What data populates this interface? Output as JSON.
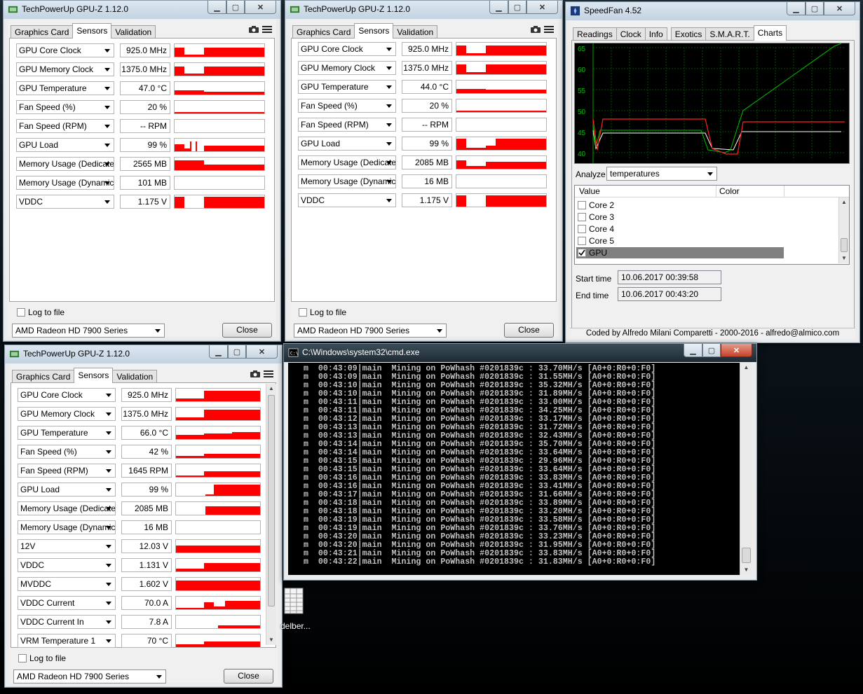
{
  "gpuz": {
    "title": "TechPowerUp GPU-Z 1.12.0",
    "tabs": [
      "Graphics Card",
      "Sensors",
      "Validation"
    ],
    "log_label": "Log to file",
    "card_name": "AMD Radeon HD 7900 Series",
    "close_label": "Close"
  },
  "gpuz1": {
    "sensors": [
      {
        "name": "GPU Core Clock",
        "value": "925.0 MHz"
      },
      {
        "name": "GPU Memory Clock",
        "value": "1375.0 MHz"
      },
      {
        "name": "GPU Temperature",
        "value": "47.0 °C"
      },
      {
        "name": "Fan Speed (%)",
        "value": "20 %"
      },
      {
        "name": "Fan Speed (RPM)",
        "value": "-- RPM"
      },
      {
        "name": "GPU Load",
        "value": "99 %"
      },
      {
        "name": "Memory Usage (Dedicated)",
        "value": "2565 MB"
      },
      {
        "name": "Memory Usage (Dynamic)",
        "value": "101 MB"
      },
      {
        "name": "VDDC",
        "value": "1.175 V"
      }
    ]
  },
  "gpuz2": {
    "sensors": [
      {
        "name": "GPU Core Clock",
        "value": "925.0 MHz"
      },
      {
        "name": "GPU Memory Clock",
        "value": "1375.0 MHz"
      },
      {
        "name": "GPU Temperature",
        "value": "44.0 °C"
      },
      {
        "name": "Fan Speed (%)",
        "value": "20 %"
      },
      {
        "name": "Fan Speed (RPM)",
        "value": "-- RPM"
      },
      {
        "name": "GPU Load",
        "value": "99 %"
      },
      {
        "name": "Memory Usage (Dedicated)",
        "value": "2085 MB"
      },
      {
        "name": "Memory Usage (Dynamic)",
        "value": "16 MB"
      },
      {
        "name": "VDDC",
        "value": "1.175 V"
      }
    ]
  },
  "gpuz3": {
    "sensors": [
      {
        "name": "GPU Core Clock",
        "value": "925.0 MHz"
      },
      {
        "name": "GPU Memory Clock",
        "value": "1375.0 MHz"
      },
      {
        "name": "GPU Temperature",
        "value": "66.0 °C"
      },
      {
        "name": "Fan Speed (%)",
        "value": "42 %"
      },
      {
        "name": "Fan Speed (RPM)",
        "value": "1645 RPM"
      },
      {
        "name": "GPU Load",
        "value": "99 %"
      },
      {
        "name": "Memory Usage (Dedicated)",
        "value": "2085 MB"
      },
      {
        "name": "Memory Usage (Dynamic)",
        "value": "16 MB"
      },
      {
        "name": "12V",
        "value": "12.03 V"
      },
      {
        "name": "VDDC",
        "value": "1.131 V"
      },
      {
        "name": "MVDDC",
        "value": "1.602 V"
      },
      {
        "name": "VDDC Current",
        "value": "70.0 A"
      },
      {
        "name": "VDDC Current In",
        "value": "7.8 A"
      },
      {
        "name": "VRM Temperature 1",
        "value": "70 °C"
      }
    ]
  },
  "speedfan": {
    "title": "SpeedFan 4.52",
    "tabs": [
      "Readings",
      "Clock",
      "Info",
      "Exotics",
      "S.M.A.R.T.",
      "Charts"
    ],
    "y_ticks": [
      "65",
      "60",
      "55",
      "50",
      "45",
      "40"
    ],
    "analyze_label": "Analyze",
    "analyze_value": "temperatures",
    "list_headers": [
      "Value",
      "Color"
    ],
    "list_items": [
      {
        "label": "Core 2",
        "checked": false
      },
      {
        "label": "Core 3",
        "checked": false
      },
      {
        "label": "Core 4",
        "checked": false
      },
      {
        "label": "Core 5",
        "checked": false
      },
      {
        "label": "GPU",
        "checked": true
      }
    ],
    "start_label": "Start time",
    "start_value": "10.06.2017 00:39:58",
    "end_label": "End time",
    "end_value": "10.06.2017 00:43:20",
    "footer": "Coded by Alfredo Milani Comparetti - 2000-2016 - alfredo@almico.com"
  },
  "cmd": {
    "title": "C:\\Windows\\system32\\cmd.exe",
    "lines": [
      "  m  00:43:09|main  Mining on PoWhash #0201839c : 33.70MH/s [A0+0:R0+0:F0]",
      "  m  00:43:09|main  Mining on PoWhash #0201839c : 31.55MH/s [A0+0:R0+0:F0]",
      "  m  00:43:10|main  Mining on PoWhash #0201839c : 35.32MH/s [A0+0:R0+0:F0]",
      "  m  00:43:10|main  Mining on PoWhash #0201839c : 31.89MH/s [A0+0:R0+0:F0]",
      "  m  00:43:11|main  Mining on PoWhash #0201839c : 33.00MH/s [A0+0:R0+0:F0]",
      "  m  00:43:11|main  Mining on PoWhash #0201839c : 34.25MH/s [A0+0:R0+0:F0]",
      "  m  00:43:12|main  Mining on PoWhash #0201839c : 33.17MH/s [A0+0:R0+0:F0]",
      "  m  00:43:13|main  Mining on PoWhash #0201839c : 31.72MH/s [A0+0:R0+0:F0]",
      "  m  00:43:13|main  Mining on PoWhash #0201839c : 32.43MH/s [A0+0:R0+0:F0]",
      "  m  00:43:14|main  Mining on PoWhash #0201839c : 35.70MH/s [A0+0:R0+0:F0]",
      "  m  00:43:14|main  Mining on PoWhash #0201839c : 33.64MH/s [A0+0:R0+0:F0]",
      "  m  00:43:15|main  Mining on PoWhash #0201839c : 29.96MH/s [A0+0:R0+0:F0]",
      "  m  00:43:15|main  Mining on PoWhash #0201839c : 33.64MH/s [A0+0:R0+0:F0]",
      "  m  00:43:16|main  Mining on PoWhash #0201839c : 33.83MH/s [A0+0:R0+0:F0]",
      "  m  00:43:16|main  Mining on PoWhash #0201839c : 33.41MH/s [A0+0:R0+0:F0]",
      "  m  00:43:17|main  Mining on PoWhash #0201839c : 31.66MH/s [A0+0:R0+0:F0]",
      "  m  00:43:18|main  Mining on PoWhash #0201839c : 33.89MH/s [A0+0:R0+0:F0]",
      "  m  00:43:18|main  Mining on PoWhash #0201839c : 33.20MH/s [A0+0:R0+0:F0]",
      "  m  00:43:19|main  Mining on PoWhash #0201839c : 33.58MH/s [A0+0:R0+0:F0]",
      "  m  00:43:19|main  Mining on PoWhash #0201839c : 33.76MH/s [A0+0:R0+0:F0]",
      "  m  00:43:20|main  Mining on PoWhash #0201839c : 33.23MH/s [A0+0:R0+0:F0]",
      "  m  00:43:20|main  Mining on PoWhash #0201839c : 31.95MH/s [A0+0:R0+0:F0]",
      "  m  00:43:21|main  Mining on PoWhash #0201839c : 33.83MH/s [A0+0:R0+0:F0]",
      "  m  00:43:22|main  Mining on PoWhash #0201839c : 31.83MH/s [A0+0:R0+0:F0]"
    ]
  },
  "desktop_icon_label": "delber...",
  "colors": {
    "graph_red": "#ff0000",
    "chart_green": "#00c000",
    "chart_red": "#ff2020",
    "chart_white": "#ffffff",
    "grid": "#005000"
  }
}
